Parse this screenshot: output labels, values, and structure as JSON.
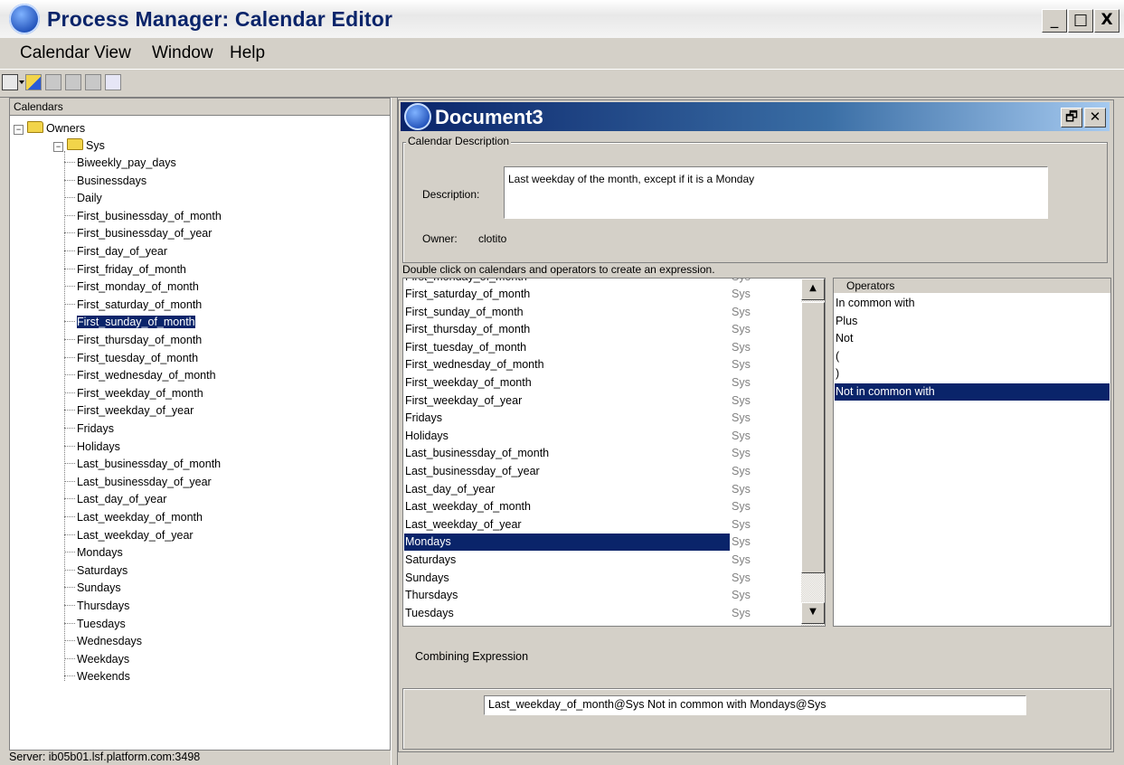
{
  "window": {
    "title": "Process Manager: Calendar Editor",
    "controls": [
      "_",
      "□",
      "X"
    ]
  },
  "menu": [
    "Calendar",
    "View",
    "Window",
    "Help"
  ],
  "toolbar_icons": [
    "new-calendar-icon",
    "open-icon",
    "delete-icon",
    "save-icon",
    "preview-icon",
    "refresh-icon"
  ],
  "calendars_panel": {
    "header": "Calendars",
    "root": "Owners",
    "owner": "Sys",
    "items": [
      "Biweekly_pay_days",
      "Businessdays",
      "Daily",
      "First_businessday_of_month",
      "First_businessday_of_year",
      "First_day_of_year",
      "First_friday_of_month",
      "First_monday_of_month",
      "First_saturday_of_month",
      "First_sunday_of_month",
      "First_thursday_of_month",
      "First_tuesday_of_month",
      "First_wednesday_of_month",
      "First_weekday_of_month",
      "First_weekday_of_year",
      "Fridays",
      "Holidays",
      "Last_businessday_of_month",
      "Last_businessday_of_year",
      "Last_day_of_year",
      "Last_weekday_of_month",
      "Last_weekday_of_year",
      "Mondays",
      "Saturdays",
      "Sundays",
      "Thursdays",
      "Tuesdays",
      "Wednesdays",
      "Weekdays",
      "Weekends"
    ],
    "selected": "First_sunday_of_month"
  },
  "document": {
    "title": "Document3",
    "group_label": "Calendar Description",
    "description_label": "Description:",
    "description": "Last weekday of the month, except if it is a Monday",
    "owner_label": "Owner:",
    "owner": "clotito",
    "hint": "Double click on calendars and operators to create an expression.",
    "calendar_list": {
      "partial_top": {
        "name": "First_monday_of_month",
        "owner": "Sys"
      },
      "rows": [
        {
          "name": "First_saturday_of_month",
          "owner": "Sys"
        },
        {
          "name": "First_sunday_of_month",
          "owner": "Sys"
        },
        {
          "name": "First_thursday_of_month",
          "owner": "Sys"
        },
        {
          "name": "First_tuesday_of_month",
          "owner": "Sys"
        },
        {
          "name": "First_wednesday_of_month",
          "owner": "Sys"
        },
        {
          "name": "First_weekday_of_month",
          "owner": "Sys"
        },
        {
          "name": "First_weekday_of_year",
          "owner": "Sys"
        },
        {
          "name": "Fridays",
          "owner": "Sys"
        },
        {
          "name": "Holidays",
          "owner": "Sys"
        },
        {
          "name": "Last_businessday_of_month",
          "owner": "Sys"
        },
        {
          "name": "Last_businessday_of_year",
          "owner": "Sys"
        },
        {
          "name": "Last_day_of_year",
          "owner": "Sys"
        },
        {
          "name": "Last_weekday_of_month",
          "owner": "Sys"
        },
        {
          "name": "Last_weekday_of_year",
          "owner": "Sys"
        },
        {
          "name": "Mondays",
          "owner": "Sys"
        },
        {
          "name": "Saturdays",
          "owner": "Sys"
        },
        {
          "name": "Sundays",
          "owner": "Sys"
        },
        {
          "name": "Thursdays",
          "owner": "Sys"
        },
        {
          "name": "Tuesdays",
          "owner": "Sys"
        }
      ],
      "selected": "Mondays"
    },
    "operators": {
      "header": "Operators",
      "items": [
        "In common with",
        "Plus",
        "Not",
        "(",
        ")",
        "Not in common with"
      ],
      "selected": "Not in common with"
    },
    "combining_label": "Combining Expression",
    "expression": "Last_weekday_of_month@Sys  Not in common with  Mondays@Sys"
  },
  "status": "Server: ib05b01.lsf.platform.com:3498",
  "colors": {
    "selection": "#0a246a",
    "face": "#d4d0c8",
    "title_text": "#0a246a"
  }
}
